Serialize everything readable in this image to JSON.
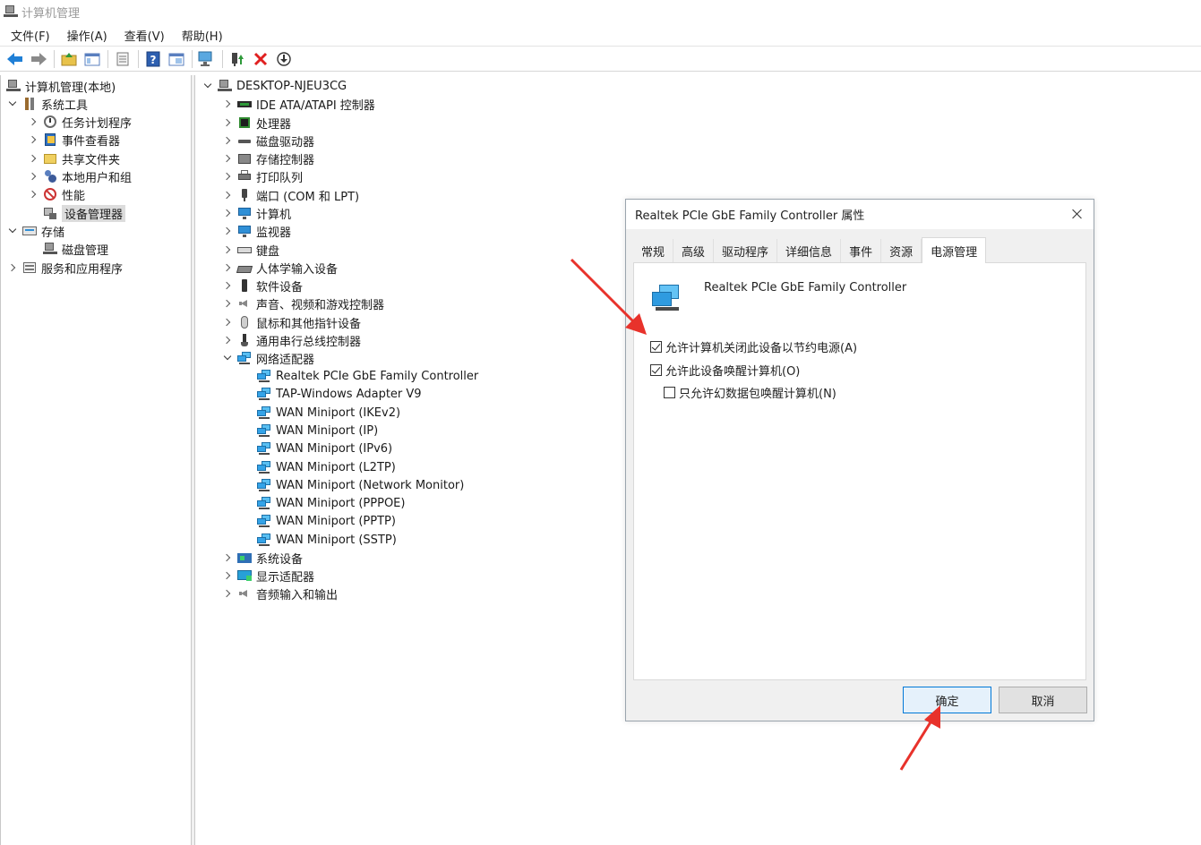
{
  "window": {
    "title": "计算机管理"
  },
  "menu": [
    {
      "label": "文件(F)"
    },
    {
      "label": "操作(A)"
    },
    {
      "label": "查看(V)"
    },
    {
      "label": "帮助(H)"
    }
  ],
  "toolbar": {
    "icons": [
      "back-arrow-icon",
      "forward-arrow-icon",
      "up-folder-icon",
      "show-hide-tree-icon",
      "properties-icon",
      "help-icon",
      "view-icon",
      "monitor-icon",
      "update-driver-icon",
      "uninstall-icon",
      "download-icon"
    ],
    "accent_colors": {
      "arrows": "#1f7fd6",
      "delete": "#e02020"
    }
  },
  "left_tree": {
    "root": "计算机管理(本地)",
    "system_tools": "系统工具",
    "task_scheduler": "任务计划程序",
    "event_viewer": "事件查看器",
    "shared_folders": "共享文件夹",
    "local_users": "本地用户和组",
    "performance": "性能",
    "device_manager": "设备管理器",
    "storage": "存储",
    "disk_management": "磁盘管理",
    "services_apps": "服务和应用程序"
  },
  "device_tree": {
    "root": "DESKTOP-NJEU3CG",
    "categories": {
      "ide": "IDE ATA/ATAPI 控制器",
      "processor": "处理器",
      "disk_drives": "磁盘驱动器",
      "storage_controllers": "存储控制器",
      "print_queues": "打印队列",
      "ports": "端口 (COM 和 LPT)",
      "computer": "计算机",
      "monitors": "监视器",
      "keyboards": "键盘",
      "hid": "人体学输入设备",
      "software_devices": "软件设备",
      "sound": "声音、视频和游戏控制器",
      "mice": "鼠标和其他指针设备",
      "usb": "通用串行总线控制器",
      "network_adapters": "网络适配器",
      "system_devices": "系统设备",
      "display_adapters": "显示适配器",
      "audio_io": "音频输入和输出"
    },
    "network_adapters": [
      "Realtek PCIe GbE Family Controller",
      "TAP-Windows Adapter V9",
      "WAN Miniport (IKEv2)",
      "WAN Miniport (IP)",
      "WAN Miniport (IPv6)",
      "WAN Miniport (L2TP)",
      "WAN Miniport (Network Monitor)",
      "WAN Miniport (PPPOE)",
      "WAN Miniport (PPTP)",
      "WAN Miniport (SSTP)"
    ]
  },
  "dialog": {
    "title": "Realtek PCIe GbE Family Controller 属性",
    "tabs": [
      "常规",
      "高级",
      "驱动程序",
      "详细信息",
      "事件",
      "资源",
      "电源管理"
    ],
    "active_tab": "电源管理",
    "device_name": "Realtek PCIe GbE Family Controller",
    "options": [
      {
        "label": "允许计算机关闭此设备以节约电源(A)",
        "checked": true
      },
      {
        "label": "允许此设备唤醒计算机(O)",
        "checked": true
      },
      {
        "label": "只允许幻数据包唤醒计算机(N)",
        "checked": false
      }
    ],
    "ok_label": "确定",
    "cancel_label": "取消"
  },
  "annotation_color": "#e8322b"
}
